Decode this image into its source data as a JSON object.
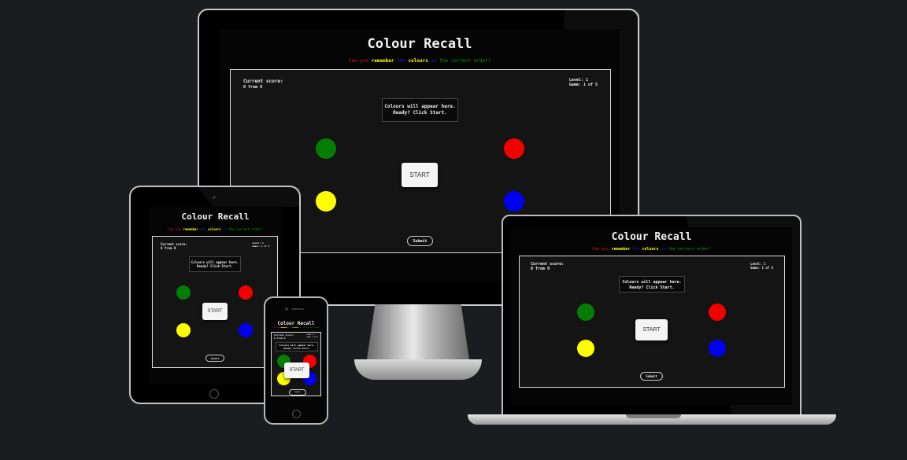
{
  "game": {
    "title": "Colour Recall",
    "tagline": {
      "p1": "Can you ",
      "w_remember": "remember",
      "p2": " the ",
      "w_colours": "colours",
      "p3": " in ",
      "p4": "the correct order?"
    },
    "score_label": "Current score:",
    "score_value": "0 from 0",
    "level": "Level: 1",
    "game_count": "Game: 1 of 5",
    "message_line1": "Colours will appear here.",
    "message_line2": "Ready? Click Start.",
    "start_label": "START",
    "submit_label": "Submit",
    "dots": [
      "green",
      "red",
      "yellow",
      "blue"
    ]
  },
  "colors": {
    "background": "#1b1c20",
    "red": "#f20000",
    "green": "#047d04",
    "yellow": "#ffff00",
    "blue": "#0000f0"
  },
  "devices": [
    "desktop-monitor",
    "tablet",
    "phone",
    "laptop"
  ]
}
